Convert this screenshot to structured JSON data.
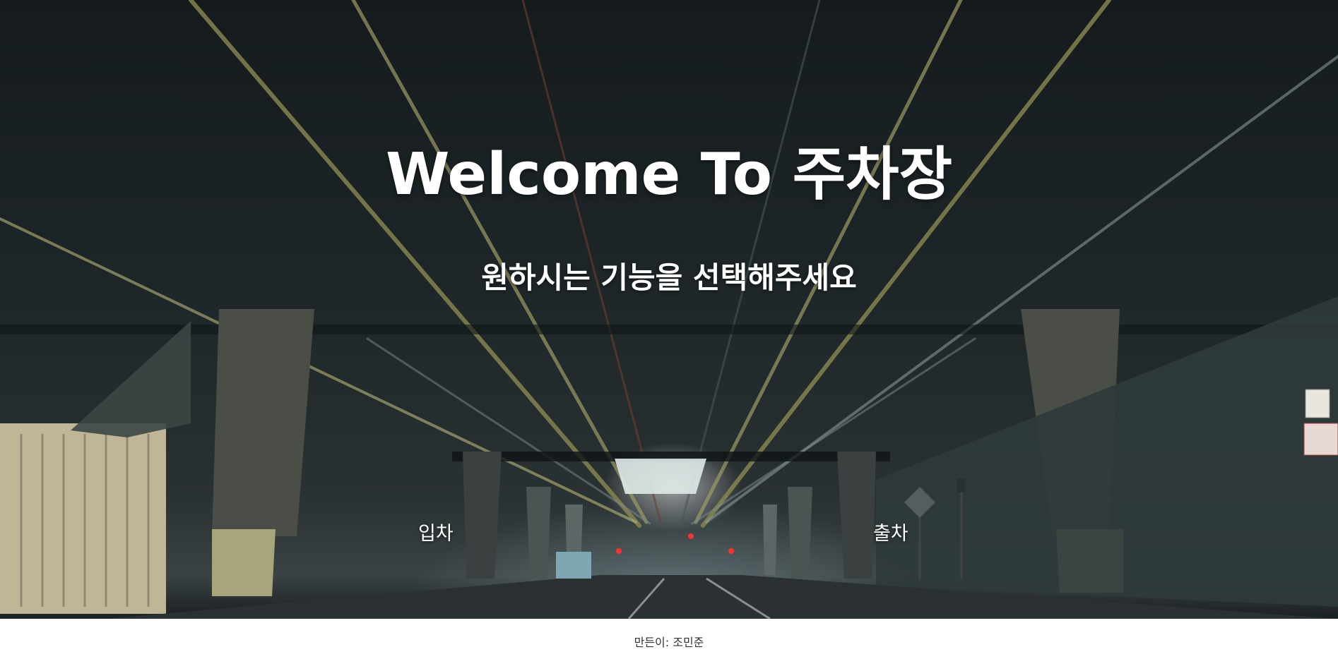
{
  "hero": {
    "title": "Welcome To 주차장",
    "subtitle": "원하시는 기능을 선택해주세요",
    "background_image": "underground-parking-garage-photo"
  },
  "actions": {
    "entry_label": "입차",
    "exit_label": "출차"
  },
  "footer": {
    "credit": "만든이: 조민준"
  },
  "colors": {
    "text": "#ffffff",
    "footer_bg": "#ffffff",
    "footer_text": "#333333"
  }
}
